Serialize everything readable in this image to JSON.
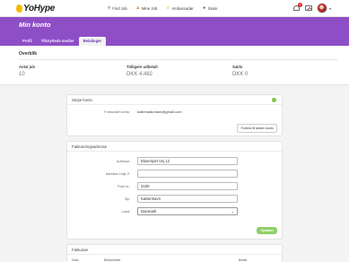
{
  "brand": {
    "name": "YoHype"
  },
  "nav": [
    {
      "icon": "search-icon",
      "label": "Find Job"
    },
    {
      "icon": "person-icon",
      "label": "Mine Job"
    },
    {
      "icon": "crown-icon",
      "label": "Ambassadør"
    },
    {
      "icon": "star-icon",
      "label": "Skole"
    }
  ],
  "notifications": {
    "count": "1"
  },
  "header": {
    "title": "Min konto",
    "tabs": [
      "Profil",
      "Tilknyttede medier",
      "Betalinger"
    ],
    "active_tab": "Betalinger"
  },
  "overview": {
    "title": "Overblik",
    "stats": [
      {
        "label": "Antal job",
        "value": "10"
      },
      {
        "label": "Tidligere udbetalt",
        "value": "DKK 4.482"
      },
      {
        "label": "Saldo",
        "value": "DKK 0"
      }
    ]
  },
  "stripe": {
    "title": "Stripe konto",
    "status_color": "#7ac943",
    "email_label": "Forbundet konto:",
    "email": "ballemadumam@gmail.com",
    "connect_button": "Forbind til anden konto"
  },
  "billing": {
    "title": "Faktureringsadresse",
    "fields": [
      {
        "label": "Adresse:",
        "value": "Eksempel Vej 12"
      },
      {
        "label": "Adresse Linje 2:",
        "value": ""
      },
      {
        "label": "Post nr.:",
        "value": "2100"
      },
      {
        "label": "By:",
        "value": "København"
      }
    ],
    "country_label": "Land:",
    "country_value": "Danmark",
    "save_button": "Opdater"
  },
  "invoices": {
    "title": "Fakturaer",
    "columns": [
      "Dato",
      "Beskrivelse",
      "Beløb"
    ]
  },
  "colors": {
    "primary": "#8e4ec6",
    "accent": "#8fcf6a"
  }
}
